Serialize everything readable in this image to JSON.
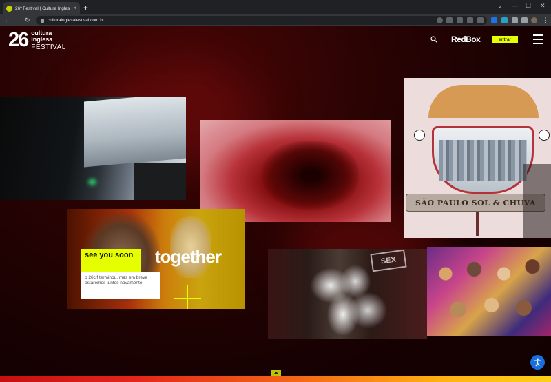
{
  "browser": {
    "tab_title": "26º Festival | Cultura Inglesa",
    "tab_close": "×",
    "new_tab": "+",
    "url": "culturainglesafestival.com.br",
    "window_controls": [
      "⌄",
      "—",
      "☐",
      "✕"
    ],
    "nav": {
      "back": "←",
      "forward": "→",
      "reload": "↻"
    },
    "menu": "⋮"
  },
  "header": {
    "logo_number": "26",
    "logo_line1": "cultura",
    "logo_line2": "inglesa",
    "logo_line3": "FESTIVAL",
    "redbox": "RedBox",
    "login_button": "entrar"
  },
  "promo": {
    "see_you_soon": "see you soon",
    "together": "together",
    "message": "o 26cif terminou, mas em breve estaremos juntos novamente."
  },
  "gallery": {
    "banner_text": "SÃO PAULO SOL & CHUVA",
    "sign_text": "SEX"
  },
  "icons": [
    "search-icon",
    "menu-icon",
    "accessibility-icon",
    "chevron-up-icon"
  ],
  "colors": {
    "accent": "#e5ff00",
    "background": "#1a0202",
    "a11y": "#1a6fdf"
  }
}
